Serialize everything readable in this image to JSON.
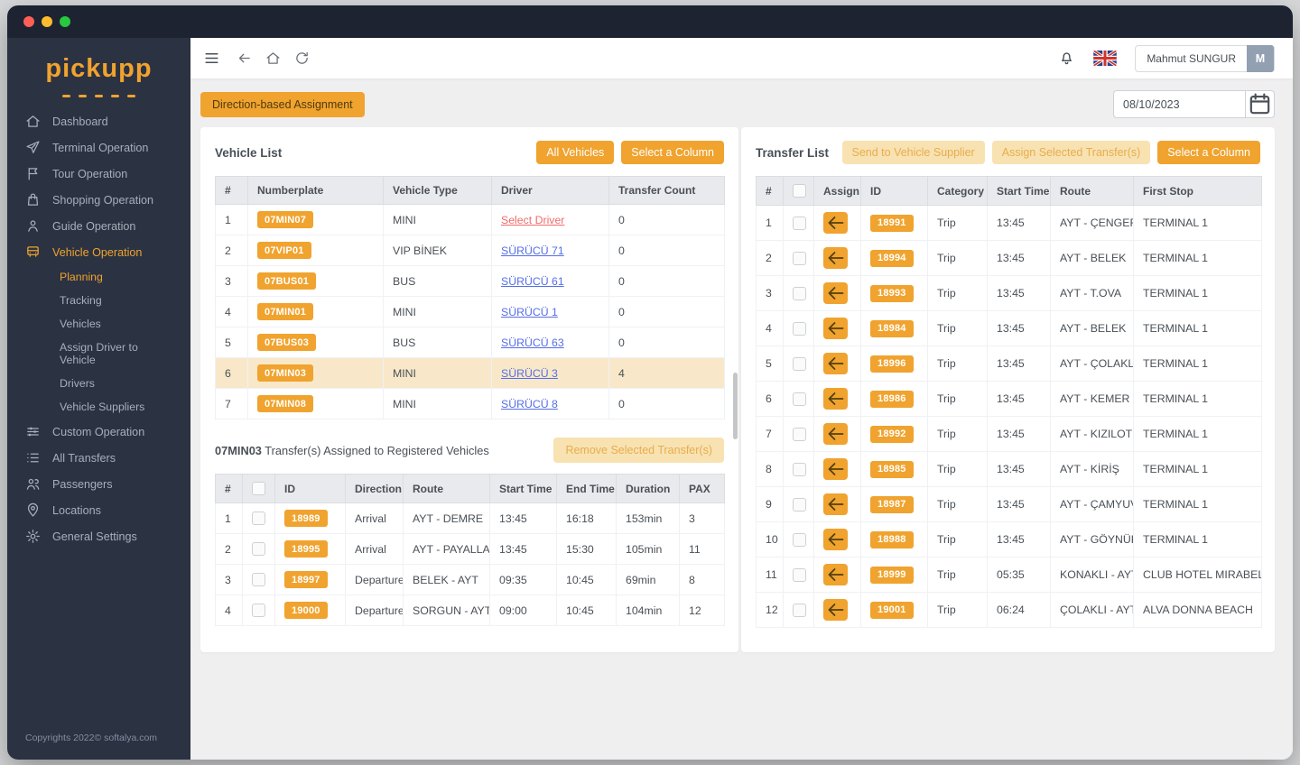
{
  "colors": {
    "accent": "#F0A32E",
    "sidebar": "#2B3242",
    "link_blue": "#556EE6",
    "link_red": "#F46A6A",
    "row_highlight": "#F8E8C9"
  },
  "sidebar": {
    "logo": "pickupp",
    "items": [
      {
        "label": "Dashboard",
        "icon": "home"
      },
      {
        "label": "Terminal Operation",
        "icon": "terminal"
      },
      {
        "label": "Tour Operation",
        "icon": "tour"
      },
      {
        "label": "Shopping Operation",
        "icon": "shopping"
      },
      {
        "label": "Guide Operation",
        "icon": "guide"
      },
      {
        "label": "Vehicle Operation",
        "icon": "vehicle",
        "active": true,
        "children": [
          "Planning",
          "Tracking",
          "Vehicles",
          "Assign Driver to Vehicle",
          "Drivers",
          "Vehicle Suppliers"
        ],
        "active_child": "Planning"
      },
      {
        "label": "Custom Operation",
        "icon": "custom"
      },
      {
        "label": "All Transfers",
        "icon": "transfers"
      },
      {
        "label": "Passengers",
        "icon": "passengers"
      },
      {
        "label": "Locations",
        "icon": "locations"
      },
      {
        "label": "General Settings",
        "icon": "settings"
      }
    ],
    "copyright": "Copyrights 2022© softalya.com"
  },
  "header": {
    "user_name": "Mahmut SUNGUR",
    "user_initial": "M"
  },
  "toolbar": {
    "assignment_button": "Direction-based Assignment",
    "date": "08/10/2023"
  },
  "vehicle_list": {
    "title": "Vehicle List",
    "all_vehicles_button": "All Vehicles",
    "select_column_button": "Select a Column",
    "columns": [
      "#",
      "Numberplate",
      "Vehicle Type",
      "Driver",
      "Transfer Count"
    ],
    "rows": [
      {
        "numberplate": "07MIN07",
        "vehicle_type": "MINI",
        "driver": "Select Driver",
        "driver_state": "unassigned",
        "transfer_count": "0"
      },
      {
        "numberplate": "07VIP01",
        "vehicle_type": "VIP BİNEK",
        "driver": "SÜRÜCÜ 71",
        "driver_state": "assigned",
        "transfer_count": "0"
      },
      {
        "numberplate": "07BUS01",
        "vehicle_type": "BUS",
        "driver": "SÜRÜCÜ 61",
        "driver_state": "assigned",
        "transfer_count": "0"
      },
      {
        "numberplate": "07MIN01",
        "vehicle_type": "MINI",
        "driver": "SÜRÜCÜ 1",
        "driver_state": "assigned",
        "transfer_count": "0"
      },
      {
        "numberplate": "07BUS03",
        "vehicle_type": "BUS",
        "driver": "SÜRÜCÜ 63",
        "driver_state": "assigned",
        "transfer_count": "0"
      },
      {
        "numberplate": "07MIN03",
        "vehicle_type": "MINI",
        "driver": "SÜRÜCÜ 3",
        "driver_state": "assigned",
        "transfer_count": "4",
        "selected": true
      },
      {
        "numberplate": "07MIN08",
        "vehicle_type": "MINI",
        "driver": "SÜRÜCÜ 8",
        "driver_state": "assigned",
        "transfer_count": "0"
      }
    ]
  },
  "assigned_transfers": {
    "title_vehicle": "07MIN03",
    "title_rest": " Transfer(s) Assigned to Registered Vehicles",
    "remove_button": "Remove Selected Transfer(s)",
    "columns": [
      "#",
      "",
      "ID",
      "Direction",
      "Route",
      "Start Time",
      "End Time",
      "Duration",
      "PAX"
    ],
    "rows": [
      {
        "id": "18989",
        "direction": "Arrival",
        "route": "AYT - DEMRE",
        "start_time": "13:45",
        "end_time": "16:18",
        "duration": "153min",
        "pax": "3"
      },
      {
        "id": "18995",
        "direction": "Arrival",
        "route": "AYT - PAYALLAR",
        "start_time": "13:45",
        "end_time": "15:30",
        "duration": "105min",
        "pax": "11"
      },
      {
        "id": "18997",
        "direction": "Departure",
        "route": "BELEK - AYT",
        "start_time": "09:35",
        "end_time": "10:45",
        "duration": "69min",
        "pax": "8"
      },
      {
        "id": "19000",
        "direction": "Departure",
        "route": "SORGUN - AYT",
        "start_time": "09:00",
        "end_time": "10:45",
        "duration": "104min",
        "pax": "12"
      }
    ]
  },
  "transfer_list": {
    "title": "Transfer List",
    "send_button": "Send to Vehicle Supplier",
    "assign_button": "Assign Selected Transfer(s)",
    "select_column_button": "Select a Column",
    "columns": [
      "#",
      "",
      "Assign",
      "ID",
      "Category",
      "Start Time",
      "Route",
      "First Stop"
    ],
    "rows": [
      {
        "id": "18991",
        "category": "Trip",
        "start_time": "13:45",
        "route": "AYT - ÇENGER",
        "first_stop": "TERMINAL 1"
      },
      {
        "id": "18994",
        "category": "Trip",
        "start_time": "13:45",
        "route": "AYT - BELEK",
        "first_stop": "TERMINAL 1"
      },
      {
        "id": "18993",
        "category": "Trip",
        "start_time": "13:45",
        "route": "AYT - T.OVA",
        "first_stop": "TERMINAL 1"
      },
      {
        "id": "18984",
        "category": "Trip",
        "start_time": "13:45",
        "route": "AYT - BELEK",
        "first_stop": "TERMINAL 1"
      },
      {
        "id": "18996",
        "category": "Trip",
        "start_time": "13:45",
        "route": "AYT - ÇOLAKLI",
        "first_stop": "TERMINAL 1"
      },
      {
        "id": "18986",
        "category": "Trip",
        "start_time": "13:45",
        "route": "AYT - KEMER",
        "first_stop": "TERMINAL 1"
      },
      {
        "id": "18992",
        "category": "Trip",
        "start_time": "13:45",
        "route": "AYT - KIZILOT",
        "first_stop": "TERMINAL 1"
      },
      {
        "id": "18985",
        "category": "Trip",
        "start_time": "13:45",
        "route": "AYT - KİRİŞ",
        "first_stop": "TERMINAL 1"
      },
      {
        "id": "18987",
        "category": "Trip",
        "start_time": "13:45",
        "route": "AYT - ÇAMYUVA",
        "first_stop": "TERMINAL 1"
      },
      {
        "id": "18988",
        "category": "Trip",
        "start_time": "13:45",
        "route": "AYT - GÖYNÜK",
        "first_stop": "TERMINAL 1"
      },
      {
        "id": "18999",
        "category": "Trip",
        "start_time": "05:35",
        "route": "KONAKLI - AYT",
        "first_stop": "CLUB HOTEL MIRABELL"
      },
      {
        "id": "19001",
        "category": "Trip",
        "start_time": "06:24",
        "route": "ÇOLAKLI - AYT",
        "first_stop": "ALVA DONNA BEACH"
      }
    ]
  }
}
